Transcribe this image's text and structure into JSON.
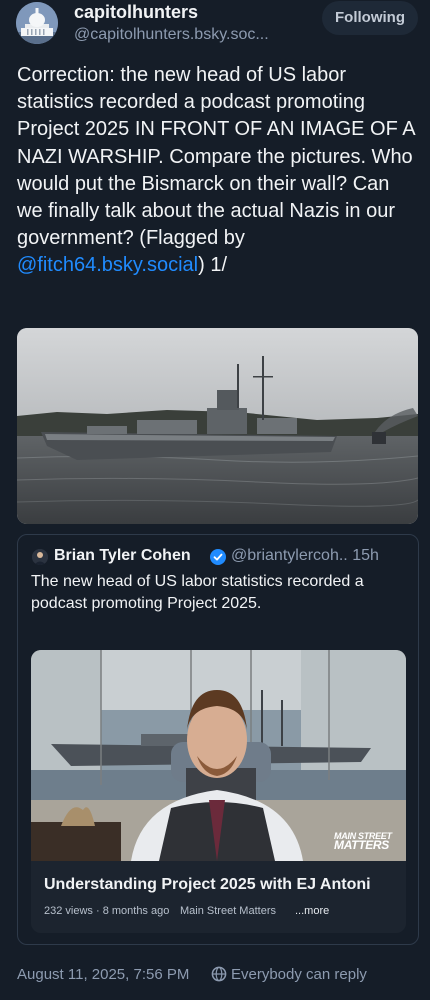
{
  "author": {
    "display_name": "capitolhunters",
    "handle": "@capitolhunters.bsky.soc...",
    "avatar_icon": "capitol-building-icon"
  },
  "follow_button": {
    "label": "Following"
  },
  "post": {
    "text_before_mention": "Correction: the new head of US labor statistics recorded a podcast promoting Project 2025 IN FRONT OF AN IMAGE OF A NAZI WARSHIP. Compare the pictures. Who would put the Bismarck on their wall? Can we finally talk about the actual Nazis in our government?  (Flagged by ",
    "mention": "@fitch64.bsky.social",
    "text_after_mention": ") 1/"
  },
  "quoted_post": {
    "display_name": "Brian Tyler Cohen",
    "verified_icon": "verified-check-icon",
    "handle": "@briantylercoh..",
    "age": "15h",
    "text": "The new head of US labor statistics recorded a podcast promoting Project 2025.",
    "video": {
      "title": "Understanding Project 2025 with EJ Antoni",
      "meta": "232 views · 8 months ago",
      "channel": "Main Street Matters",
      "more": "...more",
      "watermark_line1": "MAIN STREET",
      "watermark_line2": "MATTERS"
    }
  },
  "footer": {
    "timestamp": "August 11, 2025, 7:56 PM",
    "reply_setting": "Everybody can reply",
    "reply_icon": "globe-icon"
  },
  "colors": {
    "background": "#151d28",
    "mention": "#208bfe",
    "muted_text": "#8d9bb0",
    "verified": "#208bfe"
  }
}
